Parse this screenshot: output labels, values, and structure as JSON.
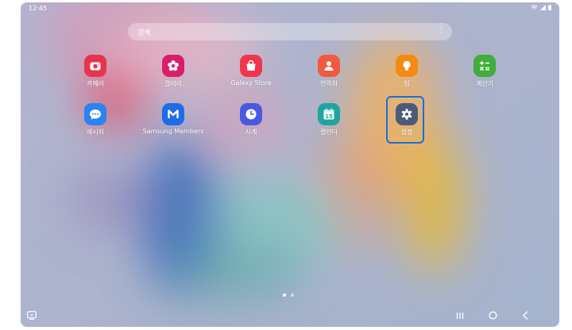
{
  "status": {
    "time": "12:45"
  },
  "search": {
    "placeholder": "검색"
  },
  "apps": [
    {
      "label": "카메라",
      "icon": "camera-icon",
      "color": "#e8334f"
    },
    {
      "label": "갤러리",
      "icon": "gallery-flower-icon",
      "color": "#d81e6b"
    },
    {
      "label": "Galaxy Store",
      "icon": "shopping-bag-icon",
      "color": "#f0354e"
    },
    {
      "label": "연락처",
      "icon": "contact-person-icon",
      "color": "#f05a40"
    },
    {
      "label": "팁",
      "icon": "lightbulb-icon",
      "color": "#f58a12"
    },
    {
      "label": "계산기",
      "icon": "calculator-icon",
      "color": "#3fae3a"
    },
    {
      "label": "메시지",
      "icon": "message-bubble-icon",
      "color": "#2b82f0"
    },
    {
      "label": "Samsung Members",
      "icon": "members-m-icon",
      "color": "#1f6ce8"
    },
    {
      "label": "시계",
      "icon": "clock-icon",
      "color": "#4a5ae0"
    },
    {
      "label": "캘린더",
      "icon": "calendar-icon",
      "color": "#1fa5a0",
      "badge": "15"
    },
    {
      "label": "설정",
      "icon": "settings-gear-icon",
      "color": "#4d5a7a"
    }
  ],
  "pager": {
    "pages": 2,
    "current": 1
  }
}
